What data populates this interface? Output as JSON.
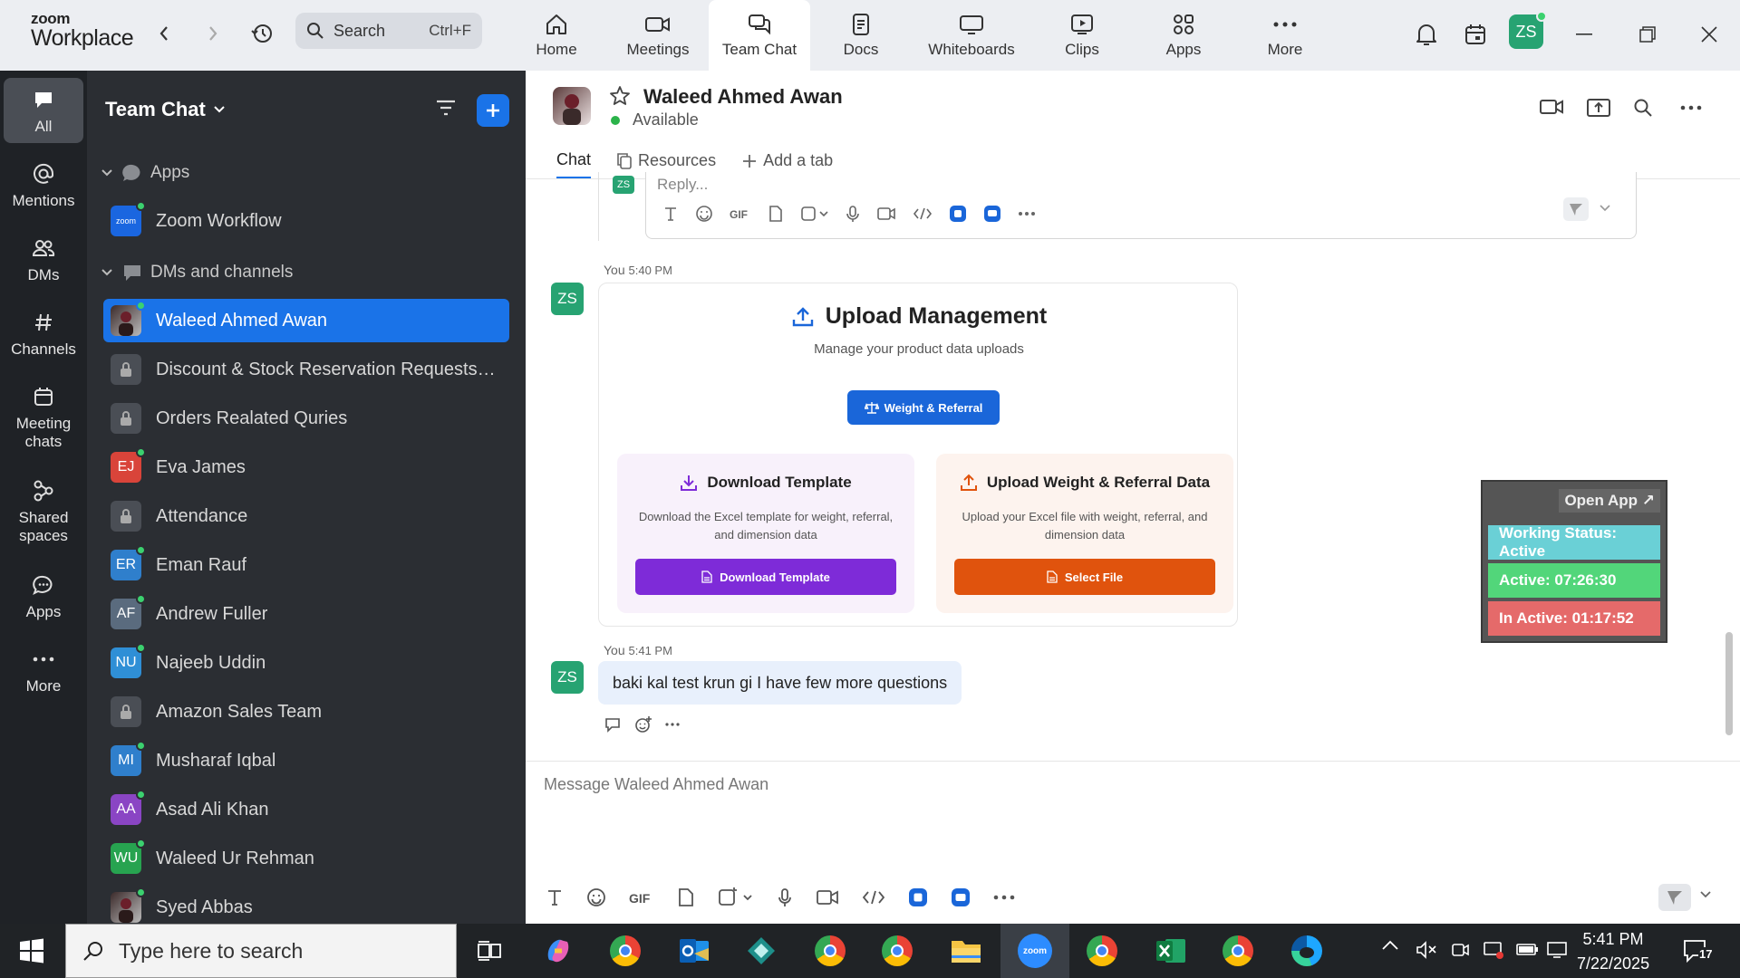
{
  "app": {
    "brand_top": "zoom",
    "brand_bottom": "Workplace"
  },
  "search": {
    "placeholder": "Search",
    "shortcut": "Ctrl+F"
  },
  "nav": [
    {
      "label": "Home",
      "icon": "home-icon"
    },
    {
      "label": "Meetings",
      "icon": "video-icon"
    },
    {
      "label": "Team Chat",
      "icon": "chat-icon",
      "active": true
    },
    {
      "label": "Docs",
      "icon": "doc-icon"
    },
    {
      "label": "Whiteboards",
      "icon": "whiteboard-icon"
    },
    {
      "label": "Clips",
      "icon": "clips-icon"
    },
    {
      "label": "Apps",
      "icon": "apps-icon"
    },
    {
      "label": "More",
      "icon": "more-icon"
    }
  ],
  "user": {
    "initials": "ZS"
  },
  "rail": [
    {
      "label": "All",
      "active": true
    },
    {
      "label": "Mentions"
    },
    {
      "label": "DMs"
    },
    {
      "label": "Channels"
    },
    {
      "label": "Meeting chats"
    },
    {
      "label": "Shared spaces"
    },
    {
      "label": "Apps"
    },
    {
      "label": "More"
    }
  ],
  "list": {
    "title": "Team Chat",
    "sections": {
      "apps": "Apps",
      "dms": "DMs and channels"
    },
    "apps_items": [
      {
        "label": "Zoom Workflow",
        "badge": "zoom"
      }
    ],
    "items": [
      {
        "label": "Waleed Ahmed Awan",
        "type": "photo",
        "selected": true,
        "online": true
      },
      {
        "label": "Discount & Stock Reservation Requests O...",
        "type": "lock"
      },
      {
        "label": "Orders Realated Quries",
        "type": "lock"
      },
      {
        "label": "Eva James",
        "type": "initials",
        "initials": "EJ",
        "color": "#d9443a",
        "online": true
      },
      {
        "label": "Attendance",
        "type": "lock"
      },
      {
        "label": "Eman Rauf",
        "type": "initials",
        "initials": "ER",
        "color": "#2f7fcc",
        "online": true
      },
      {
        "label": "Andrew Fuller",
        "type": "initials",
        "initials": "AF",
        "color": "#5a6b7e",
        "online": true
      },
      {
        "label": "Najeeb Uddin",
        "type": "initials",
        "initials": "NU",
        "color": "#2f8fd6",
        "online": true
      },
      {
        "label": "Amazon Sales Team",
        "type": "lock"
      },
      {
        "label": "Musharaf Iqbal",
        "type": "initials",
        "initials": "MI",
        "color": "#2f7fcc",
        "online": true
      },
      {
        "label": "Asad Ali Khan",
        "type": "initials",
        "initials": "AA",
        "color": "#8a45c4",
        "online": true
      },
      {
        "label": "Waleed Ur Rehman",
        "type": "initials",
        "initials": "WU",
        "color": "#27a350",
        "online": true
      },
      {
        "label": "Syed Abbas",
        "type": "photo",
        "online": true
      }
    ]
  },
  "channel": {
    "name": "Waleed Ahmed Awan",
    "status": "Available",
    "tabs": [
      "Chat",
      "Resources",
      "Add a tab"
    ],
    "reply_placeholder": "Reply..."
  },
  "messages": [
    {
      "sender": "You",
      "time": "5:40 PM",
      "initials": "ZS",
      "card": {
        "title": "Upload Management",
        "subtitle": "Manage your product data uploads",
        "pill": "Weight & Referral",
        "left": {
          "title": "Download Template",
          "desc": "Download the Excel template for weight, referral, and dimension data",
          "button": "Download Template"
        },
        "right": {
          "title": "Upload Weight & Referral Data",
          "desc": "Upload your Excel file with weight, referral, and dimension data",
          "button": "Select File"
        }
      }
    },
    {
      "sender": "You",
      "time": "5:41 PM",
      "initials": "ZS",
      "text": "baki kal test krun gi I have few more questions"
    }
  ],
  "composer": {
    "placeholder": "Message Waleed Ahmed Awan"
  },
  "widget": {
    "open_app": "Open App ↗",
    "working": "Working Status: Active",
    "active": "Active: 07:26:30",
    "inactive": "In Active: 01:17:52"
  },
  "taskbar": {
    "search_placeholder": "Type here to search",
    "time": "5:41 PM",
    "date": "7/22/2025",
    "notifications": "17"
  }
}
